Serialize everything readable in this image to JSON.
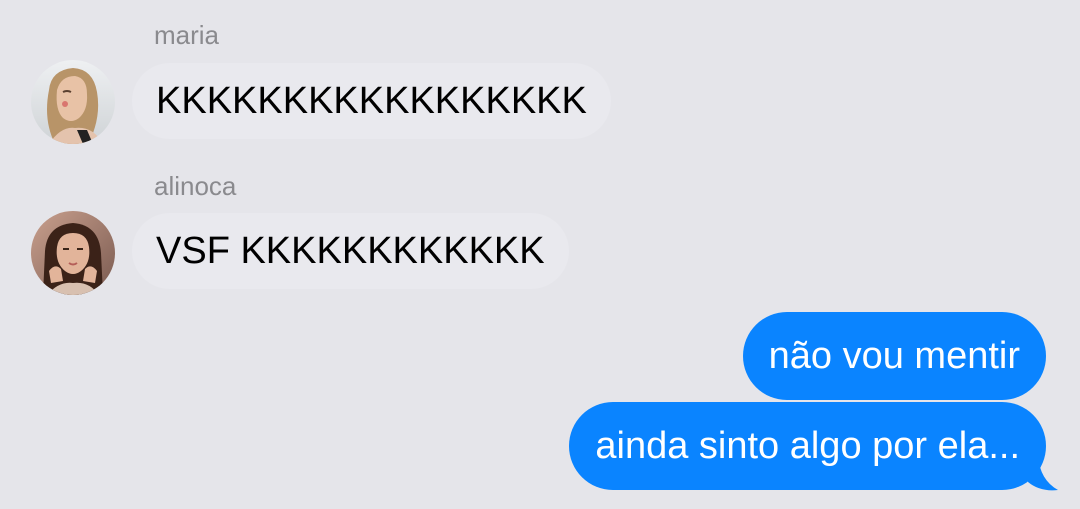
{
  "colors": {
    "background": "#e5e5ea",
    "incoming_bubble": "#e9e9ee",
    "outgoing_bubble": "#0a84ff",
    "sender_name": "#8a8a8e"
  },
  "messages": [
    {
      "direction": "incoming",
      "sender": "maria",
      "text": "KKKKKKKKKKKKKKKKK",
      "avatar": "maria-avatar-photo"
    },
    {
      "direction": "incoming",
      "sender": "alinoca",
      "text": "VSF KKKKKKKKKKKK",
      "avatar": "alinoca-avatar-photo"
    },
    {
      "direction": "outgoing",
      "text": "não vou mentir"
    },
    {
      "direction": "outgoing",
      "text": "ainda sinto algo por ela..."
    }
  ]
}
